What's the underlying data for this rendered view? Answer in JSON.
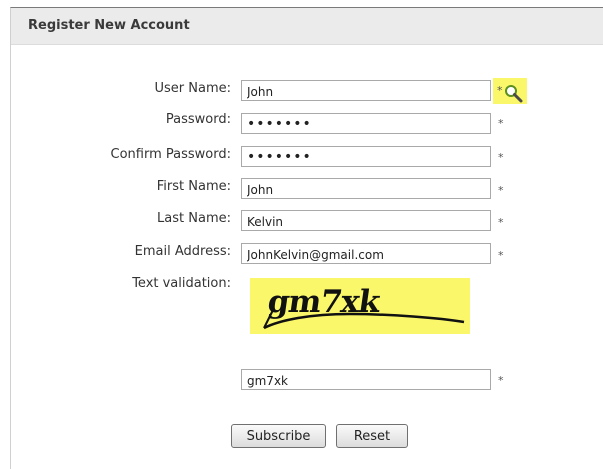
{
  "panel": {
    "title": "Register New Account"
  },
  "form": {
    "fields": [
      {
        "label": "User Name:",
        "value": "John",
        "type": "text"
      },
      {
        "label": "Password:",
        "value": "•••••••",
        "type": "password"
      },
      {
        "label": "Confirm Password:",
        "value": "•••••••",
        "type": "password"
      },
      {
        "label": "First Name:",
        "value": "John",
        "type": "text"
      },
      {
        "label": "Last Name:",
        "value": "Kelvin",
        "type": "text"
      },
      {
        "label": "Email Address:",
        "value": "JohnKelvin@gmail.com",
        "type": "text"
      }
    ],
    "required_marker": "*",
    "check_availability_icon": "magnifier-icon",
    "captcha": {
      "label": "Text validation:",
      "image_text": "gm7xk",
      "input_value": "gm7xk"
    },
    "buttons": {
      "subscribe_label": "Subscribe",
      "reset_label": "Reset"
    }
  },
  "colors": {
    "highlight": "#fbf76a",
    "header_bg": "#ebebeb",
    "field_border": "#a9a9a9"
  }
}
